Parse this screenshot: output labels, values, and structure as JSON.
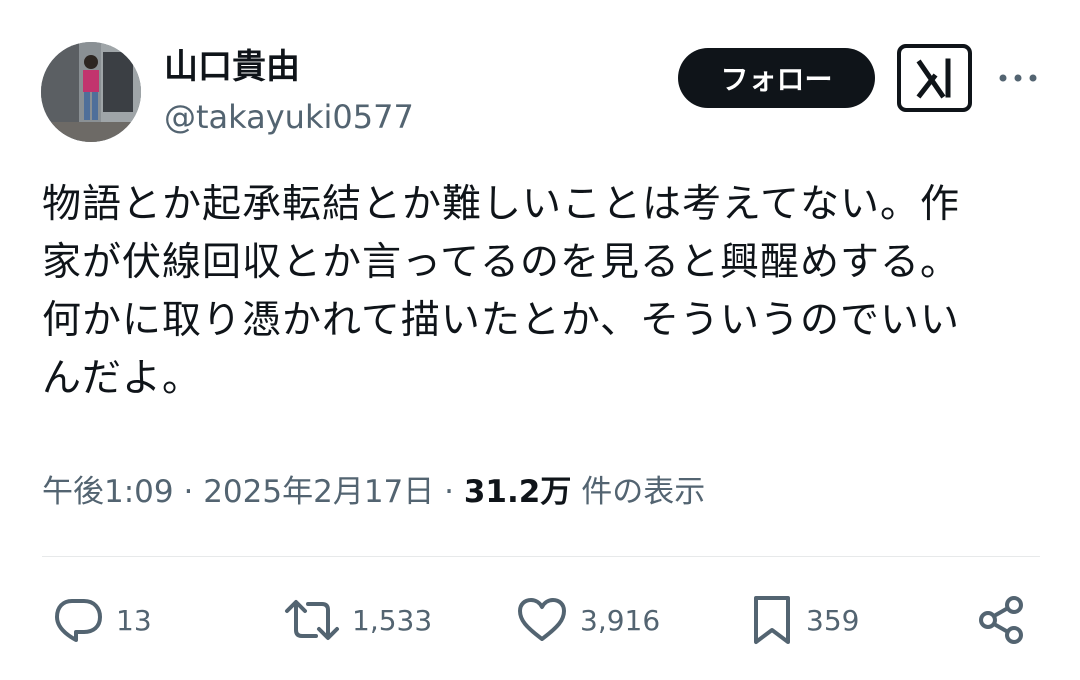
{
  "author": {
    "display_name": "山口貴由",
    "handle": "@takayuki0577"
  },
  "header": {
    "follow_label": "フォロー",
    "grok_icon": "grok-icon",
    "more_icon": "more-icon"
  },
  "tweet": {
    "lines": [
      "物語とか起承転結とか難しいことは考えてない。作",
      "家が伏線回収とか言ってるのを見ると興醒めする。",
      "何かに取り憑かれて描いたとか、そういうのでいい",
      "んだよ。"
    ]
  },
  "meta": {
    "time": "午後1:09",
    "separator": "·",
    "date": "2025年2月17日",
    "views_count": "31.2万",
    "views_label": "件の表示"
  },
  "actions": {
    "replies": {
      "icon": "reply-icon",
      "count": "13"
    },
    "reposts": {
      "icon": "repost-icon",
      "count": "1,533"
    },
    "likes": {
      "icon": "heart-icon",
      "count": "3,916"
    },
    "bookmarks": {
      "icon": "bookmark-icon",
      "count": "359"
    },
    "share": {
      "icon": "share-icon"
    }
  },
  "colors": {
    "text": "#0f1419",
    "secondary": "#536471",
    "divider": "#e7e9ea",
    "button_bg": "#0f1419"
  }
}
